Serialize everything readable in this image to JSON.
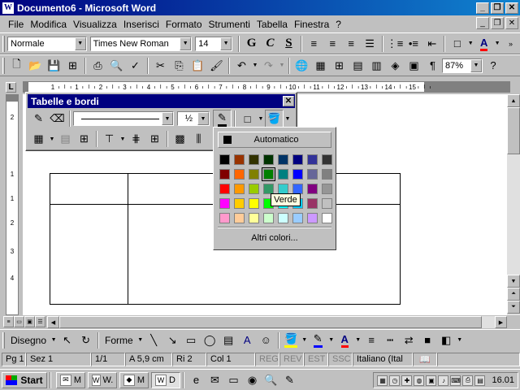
{
  "window": {
    "title": "Documento6 - Microsoft Word",
    "app_icon": "word-icon"
  },
  "menu": {
    "items": [
      {
        "label": "File"
      },
      {
        "label": "Modifica"
      },
      {
        "label": "Visualizza"
      },
      {
        "label": "Inserisci"
      },
      {
        "label": "Formato"
      },
      {
        "label": "Strumenti"
      },
      {
        "label": "Tabella"
      },
      {
        "label": "Finestra"
      },
      {
        "label": "?"
      }
    ]
  },
  "formatting": {
    "style": "Normale",
    "font": "Times New Roman",
    "size": "14",
    "bold_label": "G",
    "italic_label": "C",
    "underline_label": "S"
  },
  "standard": {
    "zoom": "87%"
  },
  "ruler": {
    "h_labels": [
      "1",
      "1",
      "2",
      "3",
      "4",
      "5",
      "6",
      "7",
      "8",
      "9",
      "10",
      "11",
      "12",
      "13",
      "14",
      "15"
    ],
    "v_labels": [
      "2",
      "1",
      "1",
      "2",
      "3",
      "4"
    ]
  },
  "tables_toolbar": {
    "title": "Tabelle e bordi",
    "line_weight": "½"
  },
  "color_popup": {
    "automatic_label": "Automatico",
    "more_colors_label": "Altri colori...",
    "tooltip": "Verde",
    "colors": [
      [
        "#000000",
        "#993300",
        "#333300",
        "#003300",
        "#003366",
        "#000080",
        "#333399",
        "#333333"
      ],
      [
        "#800000",
        "#ff6600",
        "#808000",
        "#008000",
        "#008080",
        "#0000ff",
        "#666699",
        "#808080"
      ],
      [
        "#ff0000",
        "#ff9900",
        "#99cc00",
        "#339966",
        "#33cccc",
        "#3366ff",
        "#800080",
        "#969696"
      ],
      [
        "#ff00ff",
        "#ffcc00",
        "#ffff00",
        "#00ff00",
        "#00ffff",
        "#00ccff",
        "#993366",
        "#c0c0c0"
      ],
      [
        "#ff99cc",
        "#ffcc99",
        "#ffff99",
        "#ccffcc",
        "#ccffff",
        "#99ccff",
        "#cc99ff",
        "#ffffff"
      ]
    ]
  },
  "drawing": {
    "draw_label": "Disegno",
    "shapes_label": "Forme"
  },
  "status": {
    "page": "Pg 1",
    "section": "Sez 1",
    "pages": "1/1",
    "at": "A 5,9 cm",
    "line": "Ri 2",
    "col": "Col 1",
    "rec": "REG",
    "trk": "REV",
    "ext": "EST",
    "ovr": "SSC",
    "language": "Italiano (Ital"
  },
  "taskbar": {
    "start_label": "Start",
    "buttons": [
      {
        "label": "M"
      },
      {
        "label": "W."
      },
      {
        "label": "M"
      },
      {
        "label": "D"
      }
    ],
    "clock": "16.01"
  }
}
